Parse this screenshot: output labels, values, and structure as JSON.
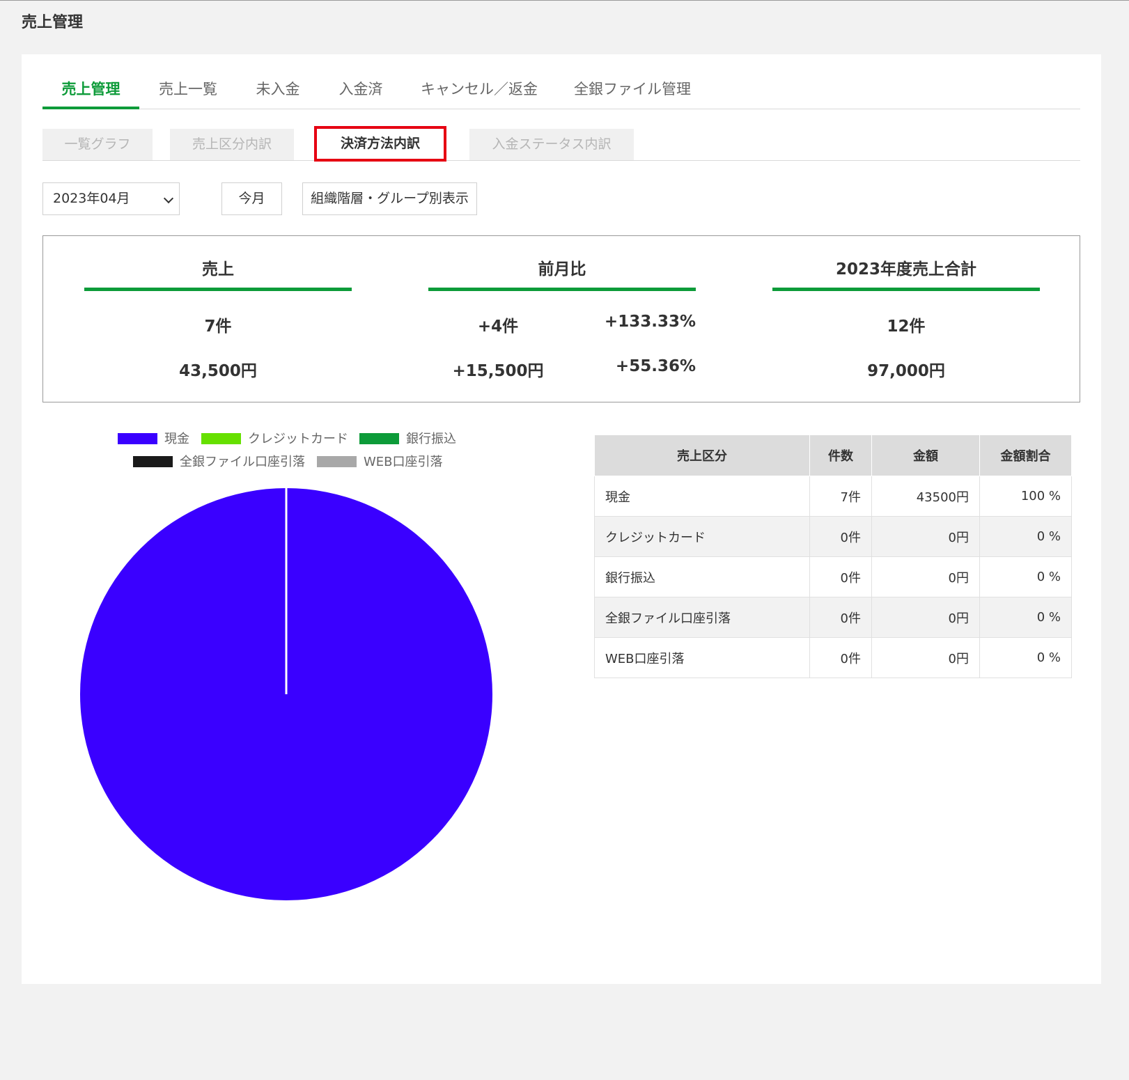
{
  "page": {
    "title": "売上管理"
  },
  "main_tabs": [
    {
      "label": "売上管理"
    },
    {
      "label": "売上一覧"
    },
    {
      "label": "未入金"
    },
    {
      "label": "入金済"
    },
    {
      "label": "キャンセル／返金"
    },
    {
      "label": "全銀ファイル管理"
    }
  ],
  "sub_tabs": [
    {
      "label": "一覧グラフ"
    },
    {
      "label": "売上区分内訳"
    },
    {
      "label": "決済方法内訳"
    },
    {
      "label": "入金ステータス内訳"
    }
  ],
  "controls": {
    "month_select_value": "2023年04月",
    "this_month_label": "今月",
    "org_view_label": "組織階層・グループ別表示"
  },
  "summary": {
    "sales": {
      "heading": "売上",
      "count": "7件",
      "amount": "43,500円"
    },
    "mom": {
      "heading": "前月比",
      "count": "+4件",
      "count_pct": "+133.33%",
      "amount": "+15,500円",
      "amount_pct": "+55.36%"
    },
    "year": {
      "heading": "2023年度売上合計",
      "count": "12件",
      "amount": "97,000円"
    }
  },
  "chart_data": {
    "type": "pie",
    "categories": [
      "現金",
      "クレジットカード",
      "銀行振込",
      "全銀ファイル口座引落",
      "WEB口座引落"
    ],
    "values": [
      43500,
      0,
      0,
      0,
      0
    ],
    "colors": [
      "#3a00ff",
      "#66e000",
      "#0d9b39",
      "#1a1a1a",
      "#a8a8a8"
    ],
    "legend_position": "top"
  },
  "table": {
    "headers": [
      "売上区分",
      "件数",
      "金額",
      "金額割合"
    ],
    "rows": [
      {
        "category": "現金",
        "count": "7件",
        "amount": "43500円",
        "ratio": "100 %"
      },
      {
        "category": "クレジットカード",
        "count": "0件",
        "amount": "0円",
        "ratio": "0 %"
      },
      {
        "category": "銀行振込",
        "count": "0件",
        "amount": "0円",
        "ratio": "0 %"
      },
      {
        "category": "全銀ファイル口座引落",
        "count": "0件",
        "amount": "0円",
        "ratio": "0 %"
      },
      {
        "category": "WEB口座引落",
        "count": "0件",
        "amount": "0円",
        "ratio": "0 %"
      }
    ]
  }
}
